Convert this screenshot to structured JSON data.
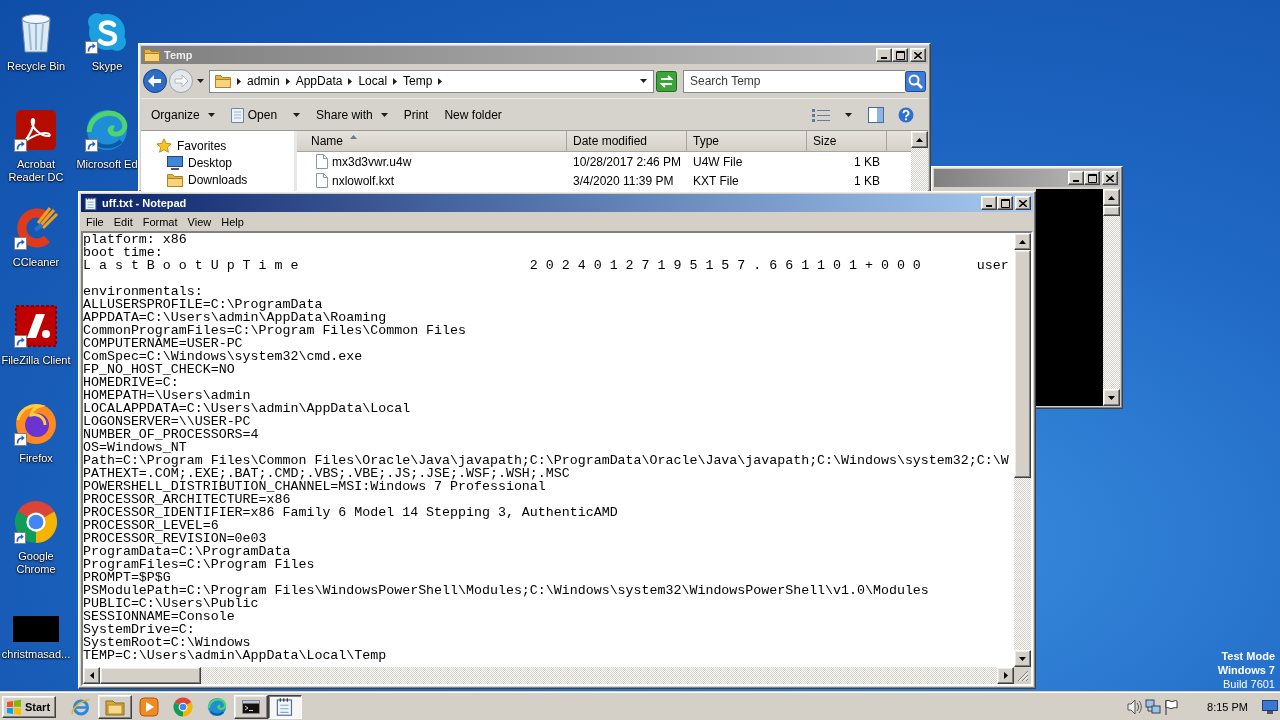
{
  "desktop": {
    "icons": [
      {
        "label": "Recycle Bin",
        "kind": "recycle-bin",
        "shortcut": false,
        "selected": false
      },
      {
        "label": "Acrobat Reader DC",
        "kind": "acrobat",
        "shortcut": true,
        "selected": false
      },
      {
        "label": "CCleaner",
        "kind": "ccleaner",
        "shortcut": true,
        "selected": false
      },
      {
        "label": "FileZilla Client",
        "kind": "filezilla",
        "shortcut": true,
        "selected": false
      },
      {
        "label": "Firefox",
        "kind": "firefox",
        "shortcut": true,
        "selected": false
      },
      {
        "label": "Google Chrome",
        "kind": "chrome",
        "shortcut": true,
        "selected": false
      },
      {
        "label": "christmasad...",
        "kind": "image-thumbnail",
        "shortcut": false,
        "selected": false
      },
      {
        "label": "Skype",
        "kind": "skype",
        "shortcut": true,
        "selected": false
      },
      {
        "label": "Microsoft Ed",
        "kind": "edge",
        "shortcut": true,
        "selected": false
      }
    ]
  },
  "os_notice": {
    "mode": "Test Mode",
    "edition": "Windows 7",
    "build": "Build 7601"
  },
  "explorer": {
    "title": "Temp",
    "active": false,
    "breadcrumb": [
      "admin",
      "AppData",
      "Local",
      "Temp"
    ],
    "search": {
      "placeholder": "Search Temp"
    },
    "toolbar": [
      {
        "label": "Organize",
        "kind": "menu"
      },
      {
        "label": "Open",
        "kind": "app-menu"
      },
      {
        "label": "Share with",
        "kind": "menu"
      },
      {
        "label": "Print",
        "kind": "command"
      },
      {
        "label": "New folder",
        "kind": "command"
      }
    ],
    "nav_pane": [
      {
        "label": "Favorites",
        "kind": "favorites",
        "selected": false,
        "children": [
          {
            "label": "Desktop",
            "kind": "desktop",
            "selected": false
          },
          {
            "label": "Downloads",
            "kind": "downloads",
            "selected": false
          }
        ]
      }
    ],
    "columns": [
      {
        "label": "Name",
        "sorted": true
      },
      {
        "label": "Date modified",
        "sorted": false
      },
      {
        "label": "Type",
        "sorted": false
      },
      {
        "label": "Size",
        "sorted": false
      }
    ],
    "rows": [
      {
        "cells": [
          "mx3d3vwr.u4w",
          "10/28/2017 2:46 PM",
          "U4W File",
          "1 KB"
        ],
        "selected": false
      },
      {
        "cells": [
          "nxlowolf.kxt",
          "3/4/2020 11:39 PM",
          "KXT File",
          "1 KB"
        ],
        "selected": false
      }
    ]
  },
  "cmd_window": {
    "active": false
  },
  "notepad": {
    "title": "uff.txt - Notepad",
    "active": true,
    "menu": [
      "File",
      "Edit",
      "Format",
      "View",
      "Help"
    ],
    "paragraphs": [
      [
        "platform: x86",
        "boot time:",
        "L a s t B o o t U p T i m e                             2 0 2 4 0 1 2 7 1 9 5 1 5 7 . 6 6 1 1 0 1 + 0 0 0       user"
      ],
      [
        "environmentals:",
        "ALLUSERSPROFILE=C:\\ProgramData",
        "APPDATA=C:\\Users\\admin\\AppData\\Roaming",
        "CommonProgramFiles=C:\\Program Files\\Common Files",
        "COMPUTERNAME=USER-PC",
        "ComSpec=C:\\Windows\\system32\\cmd.exe",
        "FP_NO_HOST_CHECK=NO",
        "HOMEDRIVE=C:",
        "HOMEPATH=\\Users\\admin",
        "LOCALAPPDATA=C:\\Users\\admin\\AppData\\Local",
        "LOGONSERVER=\\\\USER-PC",
        "NUMBER_OF_PROCESSORS=4",
        "OS=Windows_NT",
        "Path=C:\\Program Files\\Common Files\\Oracle\\Java\\javapath;C:\\ProgramData\\Oracle\\Java\\javapath;C:\\Windows\\system32;C:\\W",
        "PATHEXT=.COM;.EXE;.BAT;.CMD;.VBS;.VBE;.JS;.JSE;.WSF;.WSH;.MSC",
        "POWERSHELL_DISTRIBUTION_CHANNEL=MSI:Windows 7 Professional",
        "PROCESSOR_ARCHITECTURE=x86",
        "PROCESSOR_IDENTIFIER=x86 Family 6 Model 14 Stepping 3, AuthenticAMD",
        "PROCESSOR_LEVEL=6",
        "PROCESSOR_REVISION=0e03",
        "ProgramData=C:\\ProgramData",
        "ProgramFiles=C:\\Program Files",
        "PROMPT=$P$G",
        "PSModulePath=C:\\Program Files\\WindowsPowerShell\\Modules;C:\\Windows\\system32\\WindowsPowerShell\\v1.0\\Modules",
        "PUBLIC=C:\\Users\\Public",
        "SESSIONNAME=Console",
        "SystemDrive=C:",
        "SystemRoot=C:\\Windows",
        "TEMP=C:\\Users\\admin\\AppData\\Local\\Temp"
      ]
    ]
  },
  "taskbar": {
    "start": "Start",
    "apps": [
      {
        "kind": "ie",
        "running": false,
        "selected": false
      },
      {
        "kind": "explorer",
        "running": true,
        "selected": false
      },
      {
        "kind": "media-player",
        "running": false,
        "selected": false
      },
      {
        "kind": "chrome",
        "running": false,
        "selected": false
      },
      {
        "kind": "edge",
        "running": false,
        "selected": false
      },
      {
        "kind": "terminal",
        "running": true,
        "selected": false
      },
      {
        "kind": "notepad",
        "running": true,
        "selected": true
      }
    ],
    "clock": "8:15 PM"
  }
}
